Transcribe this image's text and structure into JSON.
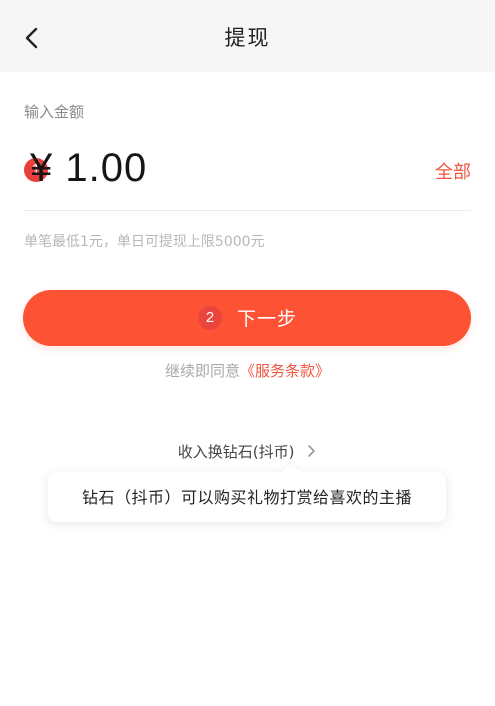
{
  "header": {
    "title": "提现",
    "back_icon": "chevron-left-icon"
  },
  "amount": {
    "label": "输入金额",
    "currency": "¥",
    "value": "1.00",
    "all_label": "全部",
    "limit_note": "单笔最低1元，单日可提现上限5000元"
  },
  "markers": {
    "marker1": "1",
    "marker2": "2"
  },
  "next_button": {
    "label": "下一步"
  },
  "agreement": {
    "prefix": "继续即同意",
    "terms_link": "《服务条款》"
  },
  "exchange": {
    "link_label": "收入换钻石(抖币)",
    "tooltip": "钻石（抖币）可以购买礼物打赏给喜欢的主播"
  },
  "colors": {
    "accent": "#fe5234",
    "link": "#f0553f",
    "marker": "#e8413b",
    "header_bg": "#f6f6f6"
  }
}
